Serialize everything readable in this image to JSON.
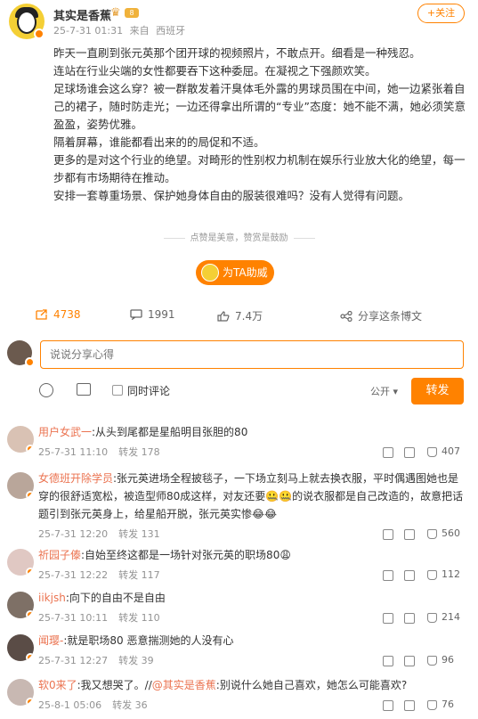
{
  "post": {
    "author": "其实是香蕉",
    "level": "8",
    "timestamp": "25-7-31 01:31",
    "source_prefix": "来自",
    "location": "西班牙",
    "follow_label": "+关注",
    "paragraphs": [
      "昨天一直刷到张元英那个团开球的视频照片，不敢点开。细看是一种残忍。",
      "连站在行业尖端的女性都要吞下这种委屈。在凝视之下强颜欢笑。",
      "足球场谁会这么穿？被一群散发着汗臭体毛外露的男球员围在中间，她一边紧张着自己的裙子，随时防走光；一边还得拿出所谓的“专业”态度：她不能不满，她必须笑意盈盈，姿势优雅。",
      "隔着屏幕，谁能都看出来的的局促和不适。",
      "更多的是对这个行业的绝望。对畸形的性别权力机制在娱乐行业放大化的绝望，每一步都有市场期待在推动。",
      "安排一套尊重场景、保护她身体自由的服装很难吗？没有人觉得有问题。"
    ],
    "like_note": "点赞是美意，赞赏是鼓励",
    "support_label": "为TA助威"
  },
  "actions": {
    "forward_count": "4738",
    "comment_count": "1991",
    "like_count": "7.4万",
    "share_label": "分享这条博文"
  },
  "composer": {
    "placeholder": "说说分享心得",
    "sync_label": "同时评论",
    "visibility": "公开",
    "submit_label": "转发"
  },
  "comments": [
    {
      "user": "用户女武一",
      "text": ":从头到尾都是星船明目张胆的80",
      "time": "25-7-31 11:10",
      "forward": "转发 178",
      "likes": "407"
    },
    {
      "user": "女德班开除学员",
      "text": ":张元英进场全程披毯子，一下场立刻马上就去换衣服，平时偶遇图她也是穿的很舒适宽松，被造型师80成这样，对友还要🤐🤐的说衣服都是自己改造的，故意把话题引到张元英身上，给星船开脱，张元英实惨😂😂",
      "time": "25-7-31 12:20",
      "forward": "转发 131",
      "likes": "560"
    },
    {
      "user": "祈园子傣",
      "text": ":自始至终这都是一场针对张元英的职场80😩",
      "time": "25-7-31 12:22",
      "forward": "转发 117",
      "likes": "112"
    },
    {
      "user": "iikjsh",
      "text": ":向下的自由不是自由",
      "time": "25-7-31 10:11",
      "forward": "转发 110",
      "likes": "214"
    },
    {
      "user": "闻璎-",
      "text": ":就是职场80 恶意揣测她的人没有心",
      "time": "25-7-31 12:27",
      "forward": "转发 39",
      "likes": "96"
    },
    {
      "user": "软0来了",
      "text_prefix": ":我又想哭了。//",
      "mention": "@其实是香蕉",
      "text_suffix": ":别说什么她自己喜欢，她怎么可能喜欢?",
      "time": "25-8-1 05:06",
      "forward": "转发 36",
      "likes": "76"
    }
  ],
  "colors": {
    "accent": "#ff8200",
    "username": "#eb7350",
    "meta": "#939393"
  }
}
